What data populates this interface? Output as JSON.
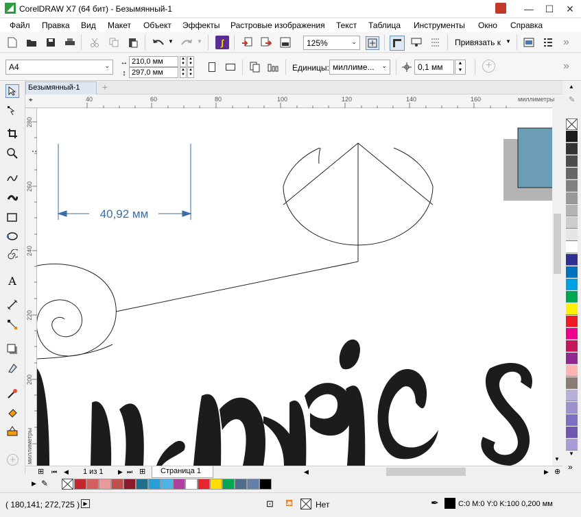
{
  "window": {
    "title": "CorelDRAW X7 (64 бит) - Безымянный-1",
    "minimize": "—",
    "maximize": "☐",
    "close": "✕"
  },
  "menu": [
    "Файл",
    "Правка",
    "Вид",
    "Макет",
    "Объект",
    "Эффекты",
    "Растровые изображения",
    "Текст",
    "Таблица",
    "Инструменты",
    "Окно",
    "Справка"
  ],
  "toolbar": {
    "zoom": "125%",
    "snap": "Привязать к",
    "more": "»"
  },
  "propbar": {
    "paper": "A4",
    "width": "210,0 мм",
    "height": "297,0 мм",
    "units_label": "Единицы:",
    "units": "миллиме...",
    "nudge": "0,1 мм",
    "more": "»"
  },
  "document": {
    "tab": "Безымянный-1",
    "add_tab": "+"
  },
  "ruler": {
    "h_ticks": [
      "40",
      "60",
      "80",
      "100",
      "120",
      "140",
      "160"
    ],
    "h_unit": "миллиметры",
    "v_ticks": [
      "280",
      "260",
      "240",
      "220",
      "200"
    ],
    "v_unit": "миллиметры"
  },
  "canvas": {
    "dimension": "40,92 мм"
  },
  "pages": {
    "counter": "1 из 1",
    "tab": "Страница 1"
  },
  "status": {
    "coords": "( 180,141; 272,725 )",
    "fill_label": "Нет",
    "outline": "C:0 M:0 Y:0 K:100  0,200 мм"
  },
  "colors": {
    "palette_vertical": [
      "#1a1a1a",
      "#333333",
      "#4d4d4d",
      "#666666",
      "#808080",
      "#999999",
      "#b3b3b3",
      "#cccccc",
      "#e6e6e6",
      "#ffffff",
      "#2e3192",
      "#0071bc",
      "#00a0e3",
      "#00a651",
      "#fff200",
      "#ed1c24",
      "#ec008c",
      "#c2185b",
      "#92278f",
      "#ffb3b3",
      "#8c7b75",
      "#b8b0d8",
      "#9e90cf",
      "#7d6fc2",
      "#6d5ab0",
      "#a99bd6"
    ],
    "palette_bottom": [
      "#c1272d",
      "#d65f5f",
      "#e89a9a",
      "#c0504d",
      "#8b1a2b",
      "#1f6f8b",
      "#2a9fd6",
      "#4fb3e8",
      "#b040a0",
      "#ffffff",
      "#e6262e",
      "#ffde00",
      "#00a651",
      "#4d6d8a",
      "#667fa8",
      "#000000"
    ],
    "accent": "#3a6ea5"
  }
}
